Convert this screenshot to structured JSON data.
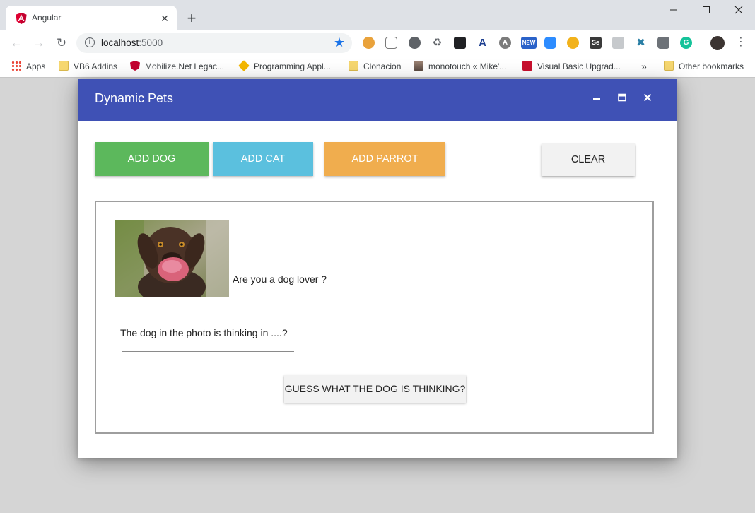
{
  "browser": {
    "tab": {
      "title": "Angular",
      "close": "✕"
    },
    "new_tab": "+",
    "window_controls": {
      "minimize": "—",
      "maximize": "☐",
      "close": "✕"
    },
    "nav": {
      "back": "←",
      "forward": "→",
      "reload": "↻"
    },
    "omnibox": {
      "host": "localhost",
      "port": ":5000"
    },
    "bookmarks": [
      {
        "label": "Apps",
        "icon": "apps-grid-icon"
      },
      {
        "label": "VB6 Addins",
        "icon": "folder-icon"
      },
      {
        "label": "Mobilize.Net Legac...",
        "icon": "angular-icon"
      },
      {
        "label": "Programming Appl...",
        "icon": "diamond-icon"
      },
      {
        "label": "Clonacion",
        "icon": "folder-icon"
      },
      {
        "label": "monotouch « Mike'...",
        "icon": "photo-icon"
      },
      {
        "label": "Visual Basic Upgrad...",
        "icon": "chart-icon"
      },
      {
        "label": "»",
        "icon": "more-icon"
      },
      {
        "label": "Other bookmarks",
        "icon": "folder-icon"
      }
    ],
    "extensions": [
      "cookie-icon",
      "puzzle-icon",
      "circle-icon",
      "recycle-icon",
      "terminal-icon",
      "a-icon",
      "a-dark-icon",
      "new-badge-icon",
      "zoom-icon",
      "moon-icon",
      "se-icon",
      "window-icon",
      "tools-icon",
      "cube-icon",
      "grammarly-icon"
    ],
    "new_badge": "NEW",
    "se_badge": "Se"
  },
  "dialog": {
    "title": "Dynamic Pets",
    "controls": {
      "minimize": "–",
      "maximize": "▪",
      "close": "✕"
    },
    "buttons": {
      "add_dog": "ADD DOG",
      "add_cat": "ADD CAT",
      "add_parrot": "ADD PARROT",
      "clear": "CLEAR"
    },
    "pet": {
      "question": "Are you a dog lover ?",
      "field_label": "The dog in the photo is thinking in ....?",
      "guess_button": "GUESS WHAT THE DOG IS THINKING?"
    }
  },
  "colors": {
    "titlebar": "#3f51b5",
    "add_dog": "#5cb85c",
    "add_cat": "#5bc0de",
    "add_parrot": "#f0ad4e"
  }
}
